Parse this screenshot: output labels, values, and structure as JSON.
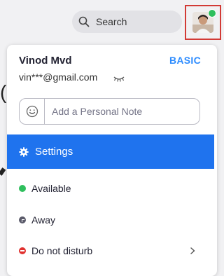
{
  "header": {
    "search_label": "Search"
  },
  "profile": {
    "name": "Vinod Mvd",
    "plan": "BASIC",
    "email": "vin***@gmail.com",
    "note_placeholder": "Add a Personal Note"
  },
  "menu": {
    "settings_label": "Settings",
    "statuses": [
      {
        "label": "Available",
        "color": "#2fbf5d",
        "icon": "status-available-dot"
      },
      {
        "label": "Away",
        "color": "#5a5a6a",
        "icon": "clock-icon"
      },
      {
        "label": "Do not disturb",
        "color": "#e0312f",
        "icon": "dnd-icon"
      }
    ]
  },
  "colors": {
    "accent": "#1f73ee",
    "plan_badge": "#2d8cff",
    "avatar_highlight": "#d23a35",
    "presence": "#2fbf5d"
  }
}
